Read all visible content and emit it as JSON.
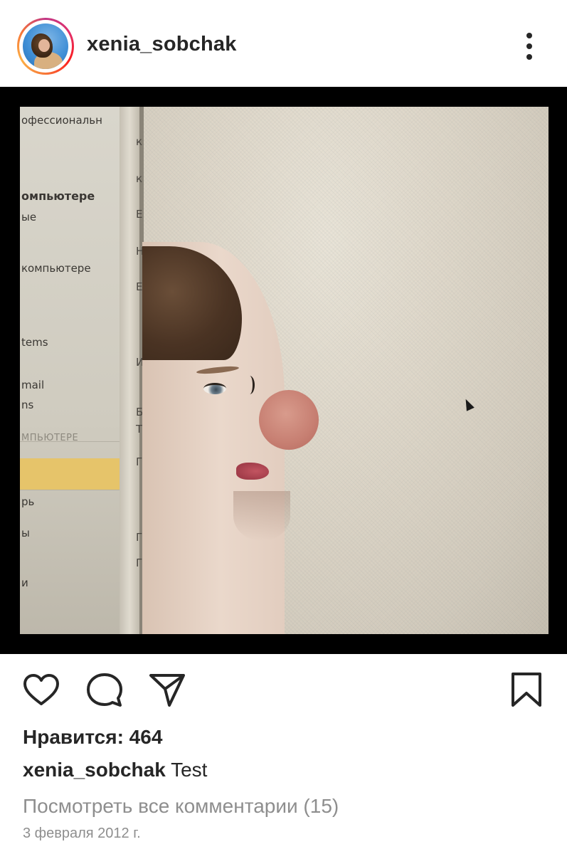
{
  "post": {
    "username": "xenia_sobchak",
    "menu_icon": "more-vertical-icon",
    "likes_text": "Нравится: 464",
    "caption_user": "xenia_sobchak",
    "caption_text": "Test",
    "view_comments": "Посмотреть все комментарии (15)",
    "date": "3 февраля 2012 г."
  },
  "photo_screen": {
    "menu_items": [
      "офессиональн",
      "омпьютере",
      "ые",
      "компьютере",
      "tems",
      "mail",
      "ns",
      "МПЬЮТЕРЕ",
      "рь",
      "ы",
      "и"
    ],
    "fold_letters": [
      "к",
      "к",
      "Е",
      "Н",
      "Е",
      "И",
      "Б",
      "Т",
      "Г",
      "Г",
      "Г"
    ]
  },
  "actions": {
    "like_icon": "heart-icon",
    "comment_icon": "comment-icon",
    "share_icon": "share-icon",
    "save_icon": "bookmark-icon"
  },
  "colors": {
    "text_primary": "#262626",
    "text_secondary": "#8e8e8e",
    "story_ring": [
      "#c13584",
      "#e1306c",
      "#fd1d1d",
      "#f77737",
      "#fcaf45"
    ]
  }
}
